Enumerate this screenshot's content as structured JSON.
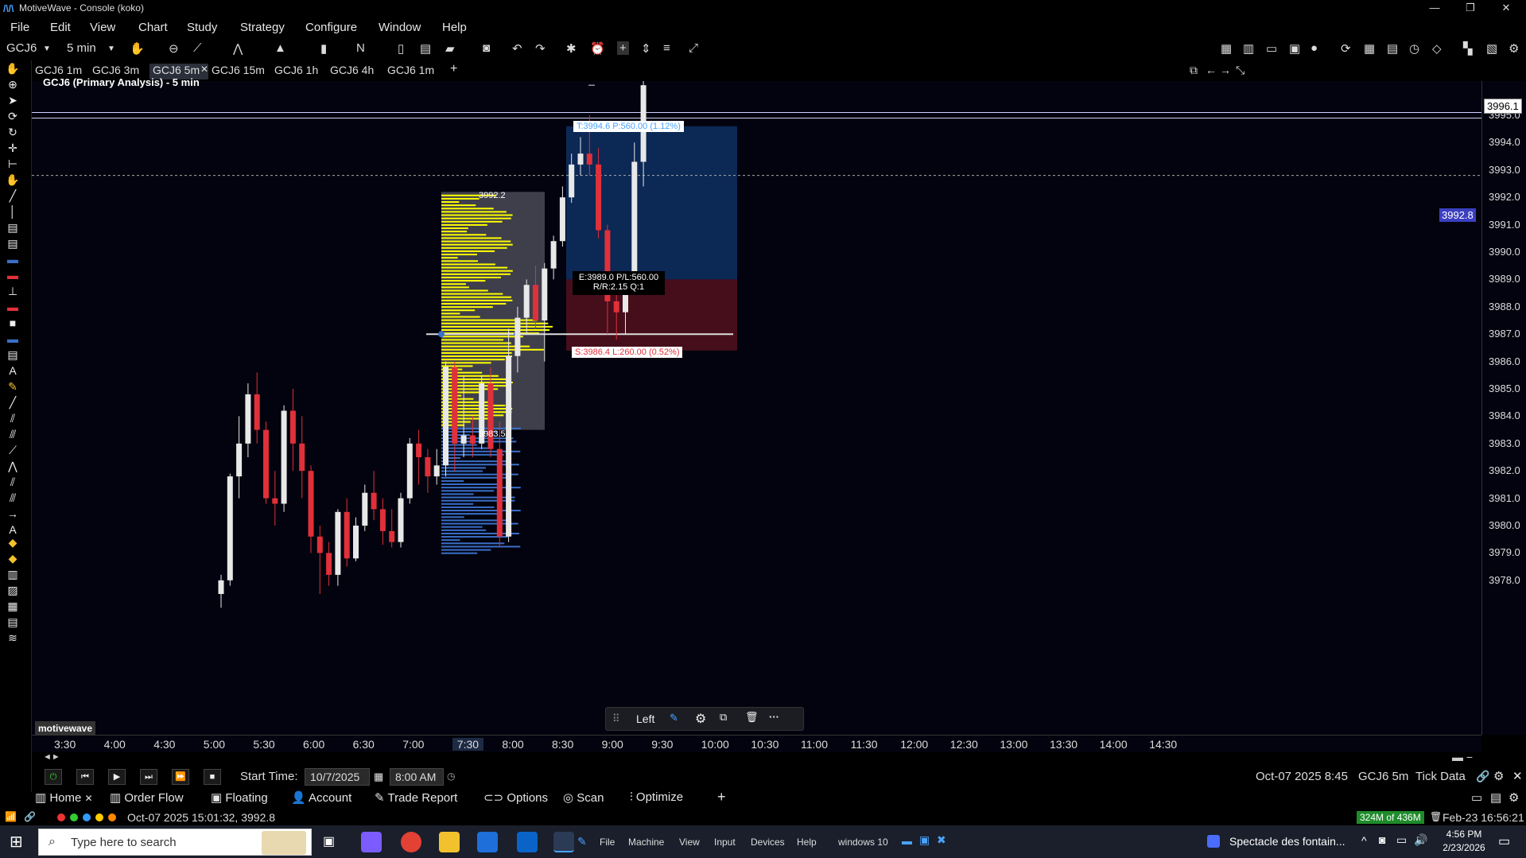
{
  "window": {
    "title": "MotiveWave - Console (koko)",
    "minimize": "—",
    "restore": "❐",
    "close": "✕"
  },
  "menu": [
    "File",
    "Edit",
    "View",
    "Chart",
    "Study",
    "Strategy",
    "Configure",
    "Window",
    "Help"
  ],
  "toolbar": {
    "symbol": "GCJ6",
    "interval": "5 min"
  },
  "tabs": [
    {
      "label": "GCJ6 1m"
    },
    {
      "label": "GCJ6 3m"
    },
    {
      "label": "GCJ6 5m",
      "active": true
    },
    {
      "label": "GCJ6 15m"
    },
    {
      "label": "GCJ6 1h"
    },
    {
      "label": "GCJ6 4h"
    },
    {
      "label": "GCJ6 1m"
    }
  ],
  "chart": {
    "title": "GCJ6 (Primary Analysis) - 5 min",
    "watermark": "motivewave",
    "current_price_label": "3996.1",
    "crosshair_price_label": "3992.8",
    "price_ticks": [
      "3995.0",
      "3994.0",
      "3993.0",
      "3992.0",
      "3991.0",
      "3990.0",
      "3989.0",
      "3988.0",
      "3987.0",
      "3986.0",
      "3985.0",
      "3984.0",
      "3983.0",
      "3982.0",
      "3981.0",
      "3980.0",
      "3979.0",
      "3978.0"
    ],
    "time_ticks": [
      "3:30",
      "4:00",
      "4:30",
      "5:00",
      "5:30",
      "6:00",
      "6:30",
      "7:00",
      "7:30",
      "8:00",
      "8:30",
      "9:00",
      "9:30",
      "10:00",
      "10:30",
      "11:00",
      "11:30",
      "12:00",
      "12:30",
      "13:00",
      "13:30",
      "14:00",
      "14:30"
    ],
    "profile_high": "3992.2",
    "profile_low": "3983.5",
    "target_label": "T:3994.6 P:560.00 (1.12%)",
    "entry_label_1": "E:3989.0 P/L:560.00",
    "entry_label_2": "R/R:2.15 Q:1",
    "stop_label": "S:3986.4 L:260.00 (0.52%)",
    "float_toolbar_text": "Left"
  },
  "chart_data": {
    "type": "candlestick",
    "title": "GCJ6 (Primary Analysis) - 5 min",
    "candles": [
      [
        3977.5,
        3978.0,
        3977.0,
        3978.2
      ],
      [
        3978.0,
        3981.8,
        3977.8,
        3981.9
      ],
      [
        3981.8,
        3983.0,
        3981.0,
        3984.0
      ],
      [
        3983.0,
        3984.8,
        3982.5,
        3985.2
      ],
      [
        3984.8,
        3983.5,
        3983.0,
        3985.6
      ],
      [
        3983.5,
        3981.0,
        3980.8,
        3983.8
      ],
      [
        3981.0,
        3980.8,
        3980.0,
        3982.0
      ],
      [
        3980.8,
        3984.2,
        3980.5,
        3984.4
      ],
      [
        3984.2,
        3983.0,
        3982.0,
        3985.0
      ],
      [
        3983.0,
        3982.0,
        3981.0,
        3984.0
      ],
      [
        3982.0,
        3979.6,
        3979.0,
        3982.2
      ],
      [
        3979.6,
        3979.0,
        3977.5,
        3980.0
      ],
      [
        3979.0,
        3978.2,
        3977.8,
        3979.4
      ],
      [
        3978.2,
        3980.5,
        3977.8,
        3980.6
      ],
      [
        3980.5,
        3978.8,
        3978.5,
        3981.0
      ],
      [
        3978.8,
        3980.0,
        3978.7,
        3980.3
      ],
      [
        3980.0,
        3981.2,
        3979.8,
        3981.5
      ],
      [
        3981.2,
        3980.6,
        3980.2,
        3982.0
      ],
      [
        3980.6,
        3979.8,
        3979.3,
        3981.0
      ],
      [
        3979.8,
        3979.4,
        3979.2,
        3980.6
      ],
      [
        3979.4,
        3981.0,
        3979.2,
        3981.2
      ],
      [
        3981.0,
        3983.0,
        3980.8,
        3983.2
      ],
      [
        3983.0,
        3982.5,
        3981.5,
        3983.5
      ],
      [
        3982.5,
        3981.8,
        3981.2,
        3982.8
      ],
      [
        3981.8,
        3982.2,
        3981.5,
        3982.8
      ],
      [
        3982.2,
        3985.8,
        3981.8,
        3986.0
      ],
      [
        3985.8,
        3983.0,
        3982.0,
        3986.0
      ],
      [
        3983.0,
        3983.3,
        3982.5,
        3985.5
      ],
      [
        3983.3,
        3983.0,
        3982.5,
        3984.0
      ],
      [
        3983.0,
        3985.2,
        3982.8,
        3985.5
      ],
      [
        3985.2,
        3982.8,
        3982.5,
        3985.8
      ],
      [
        3982.8,
        3979.6,
        3979.2,
        3983.8
      ],
      [
        3979.6,
        3986.2,
        3979.4,
        3987.2
      ],
      [
        3986.2,
        3987.6,
        3985.6,
        3988.0
      ],
      [
        3987.6,
        3988.8,
        3987.0,
        3989.0
      ],
      [
        3988.8,
        3987.5,
        3987.2,
        3989.5
      ],
      [
        3987.5,
        3989.4,
        3986.0,
        3989.6
      ],
      [
        3989.4,
        3990.4,
        3989.0,
        3990.6
      ],
      [
        3990.4,
        3992.0,
        3990.2,
        3992.4
      ],
      [
        3992.0,
        3993.2,
        3991.8,
        3993.6
      ],
      [
        3993.2,
        3993.6,
        3992.8,
        3994.2
      ],
      [
        3993.6,
        3993.2,
        3992.8,
        3995.0
      ],
      [
        3993.2,
        3990.8,
        3990.5,
        3993.8
      ],
      [
        3990.8,
        3988.2,
        3987.0,
        3991.0
      ],
      [
        3988.2,
        3987.8,
        3986.8,
        3988.6
      ],
      [
        3987.8,
        3989.0,
        3987.0,
        3989.2
      ],
      [
        3989.0,
        3993.3,
        3988.8,
        3994.0
      ],
      [
        3993.3,
        3996.1,
        3992.4,
        3997.0
      ]
    ],
    "ylim": [
      3977.5,
      3997.5
    ]
  },
  "left_tools": [
    "hand",
    "zoom",
    "pointer",
    "sync",
    "refresh",
    "crosshair",
    "measure",
    "draw",
    "line",
    "vline",
    "hbar",
    "hbar2",
    "blue-block",
    "red-block",
    "hline",
    "red-small",
    "white-block",
    "blue-small",
    "fib",
    "text",
    "pencil",
    "diag1",
    "diag2",
    "fan",
    "trend",
    "zigzag",
    "channel",
    "pitchfork",
    "arrow",
    "text2",
    "tool-a",
    "tool-b",
    "histogram",
    "area",
    "grid",
    "docs",
    "wifi"
  ],
  "replay": {
    "start_time_label": "Start Time:",
    "start_date": "10/7/2025",
    "start_time": "8:00 AM",
    "bar_time": "Oct-07 2025 8:45",
    "bar_symbol": "GCJ6 5m",
    "data_label": "Tick Data"
  },
  "bottom_tabs": [
    {
      "label": "Home",
      "icon": "home-chart-icon"
    },
    {
      "label": "Order Flow",
      "icon": "orderflow-icon"
    },
    {
      "label": "Floating",
      "icon": "floating-icon"
    },
    {
      "label": "Account",
      "icon": "account-icon"
    },
    {
      "label": "Trade Report",
      "icon": "trade-report-icon"
    },
    {
      "label": "Options",
      "icon": "options-icon"
    },
    {
      "label": "Scan",
      "icon": "scan-icon"
    },
    {
      "label": "Optimize",
      "icon": "optimize-icon"
    }
  ],
  "status": {
    "quote": "Oct-07 2025 15:01:32, 3992.8",
    "memory": "324M of 436M",
    "datetime": "Feb-23 16:56:21"
  },
  "taskbar": {
    "search_placeholder": "Type here to search",
    "vm_menu": [
      "File",
      "Machine",
      "View",
      "Input",
      "Devices",
      "Help"
    ],
    "vm_name": "windows 10",
    "notification": "Spectacle des fontain...",
    "time": "4:56 PM",
    "date": "2/23/2026"
  },
  "colors": {
    "bull": "#e8e8e8",
    "bear": "#e0303a",
    "profile": "#ffff00",
    "profile_low": "#3a6fc8",
    "target_zone": "#0d2a5a",
    "stop_zone": "#4a0f1c",
    "crosshair_box": "#3b3fbf",
    "memory_bg": "#1e8c2a"
  }
}
